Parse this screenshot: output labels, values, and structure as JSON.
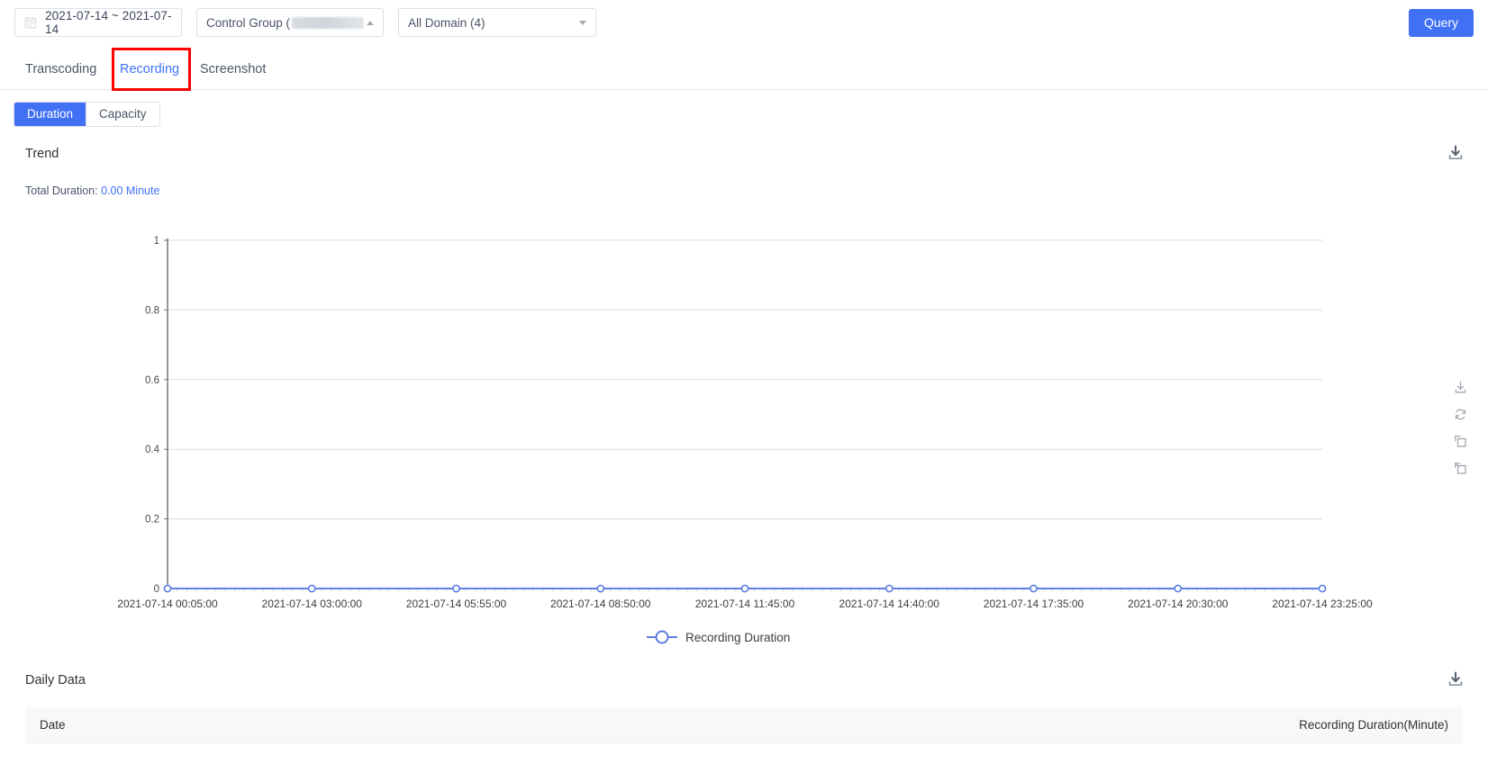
{
  "filters": {
    "date_range": "2021-07-14 ~ 2021-07-14",
    "calendar_icon": "calendar-icon",
    "control_group_label": "Control Group (",
    "control_group_redacted": true,
    "domain_select": "All Domain (4)",
    "query_button": "Query"
  },
  "tabs": [
    {
      "label": "Transcoding",
      "active": false
    },
    {
      "label": "Recording",
      "active": true
    },
    {
      "label": "Screenshot",
      "active": false
    }
  ],
  "segmented": [
    {
      "label": "Duration",
      "active": true
    },
    {
      "label": "Capacity",
      "active": false
    }
  ],
  "trend": {
    "title": "Trend",
    "total_label": "Total Duration:",
    "total_value": "0.00 Minute",
    "download_icon": "download-icon"
  },
  "toolbox": [
    {
      "name": "save-as-image-icon"
    },
    {
      "name": "restore-icon"
    },
    {
      "name": "data-zoom-icon"
    },
    {
      "name": "data-zoom-reset-icon"
    }
  ],
  "daily": {
    "title": "Daily Data",
    "download_icon": "download-icon",
    "columns": [
      "Date",
      "Recording Duration(Minute)"
    ],
    "rows": []
  },
  "colors": {
    "accent": "#4070f4",
    "series": "#5b7fe0",
    "annotation": "#ff0000",
    "grid": "#dcdcdc",
    "axis": "#333333",
    "text": "#303133"
  },
  "chart_data": {
    "type": "line",
    "title": "Trend",
    "xlabel": "",
    "ylabel": "",
    "legend": [
      "Recording Duration"
    ],
    "legend_position": "bottom",
    "grid": true,
    "ylim": [
      0,
      1
    ],
    "yticks": [
      "0",
      "0.2",
      "0.4",
      "0.6",
      "0.8",
      "1"
    ],
    "categories": [
      "2021-07-14 00:05:00",
      "2021-07-14 03:00:00",
      "2021-07-14 05:55:00",
      "2021-07-14 08:50:00",
      "2021-07-14 11:45:00",
      "2021-07-14 14:40:00",
      "2021-07-14 17:35:00",
      "2021-07-14 20:30:00",
      "2021-07-14 23:25:00"
    ],
    "series": [
      {
        "name": "Recording Duration",
        "values": [
          0,
          0,
          0,
          0,
          0,
          0,
          0,
          0,
          0
        ]
      }
    ]
  }
}
